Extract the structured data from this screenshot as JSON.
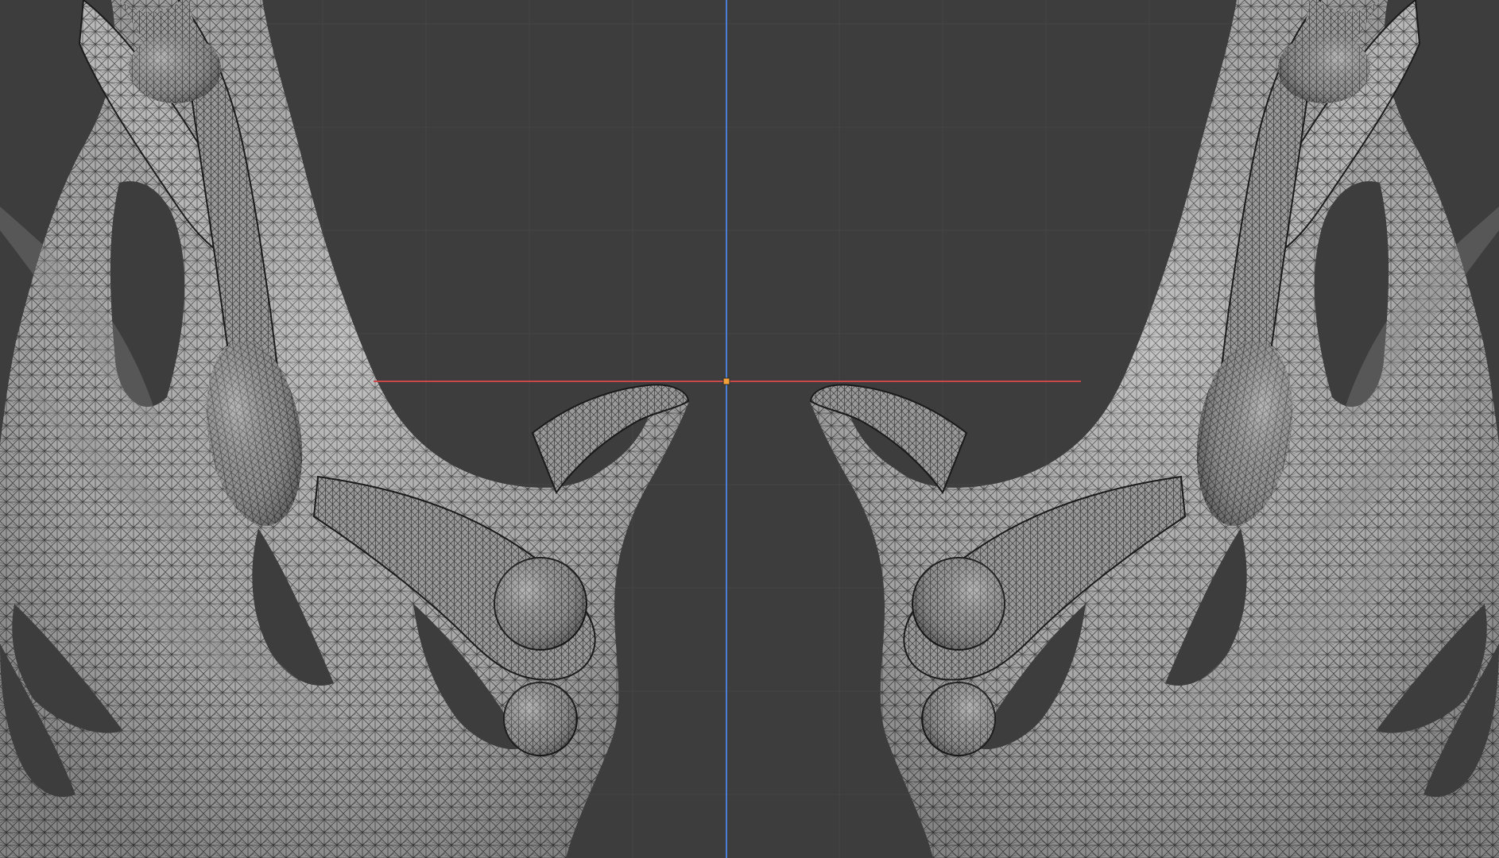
{
  "viewport": {
    "background_color": "#3d3d3d",
    "grid_color": "#474747",
    "x_axis_color": "#c8484c",
    "y_axis_color": "#4a7ed6",
    "origin_color": "#f2a13a",
    "mesh_fill_color": "#b7b7b7",
    "wire_color": "#1d1d1d",
    "mesh_shadow_color": "#858585",
    "mesh_highlight_color": "#d6d6d6"
  }
}
